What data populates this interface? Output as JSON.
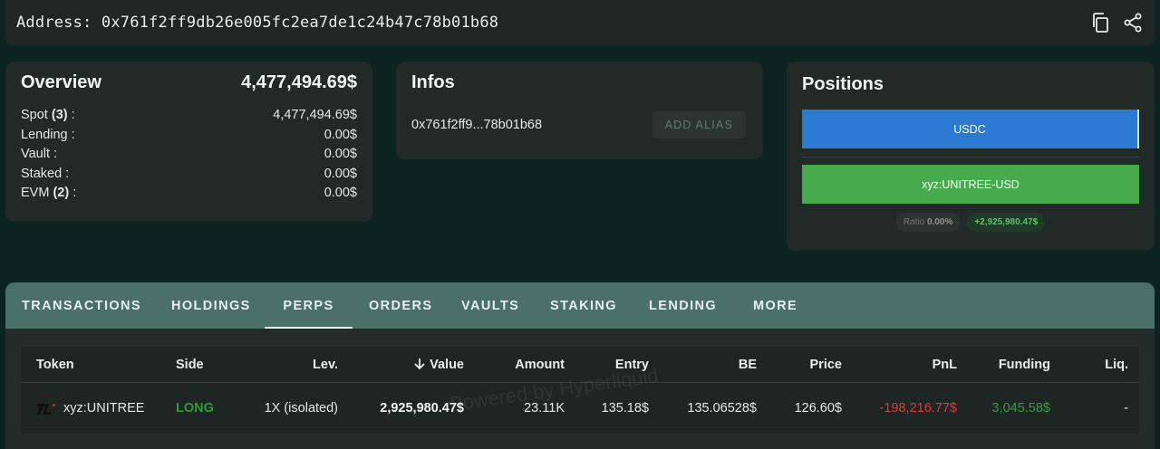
{
  "address_bar": {
    "label": "Address:",
    "address": "0x761f2ff9db26e005fc2ea7de1c24b47c78b01b68"
  },
  "overview": {
    "title": "Overview",
    "total": "4,477,494.69$",
    "rows": [
      {
        "label": "Spot",
        "count": "(3)",
        "suffix": " :",
        "value": "4,477,494.69$"
      },
      {
        "label": "Lending :",
        "count": "",
        "suffix": "",
        "value": "0.00$"
      },
      {
        "label": "Vault :",
        "count": "",
        "suffix": "",
        "value": "0.00$"
      },
      {
        "label": "Staked :",
        "count": "",
        "suffix": "",
        "value": "0.00$"
      },
      {
        "label": "EVM",
        "count": "(2)",
        "suffix": " :",
        "value": "0.00$"
      }
    ]
  },
  "infos": {
    "title": "Infos",
    "short_address": "0x761f2ff9...78b01b68",
    "alias_button": "ADD ALIAS"
  },
  "positions": {
    "title": "Positions",
    "bars": [
      "USDC",
      "xyz:UNITREE-USD"
    ],
    "ratio_label": "Ratio",
    "ratio_value": "0.00%",
    "pnl_badge": "+2,925,980.47$"
  },
  "tabs": [
    "TRANSACTIONS",
    "HOLDINGS",
    "PERPS",
    "ORDERS",
    "VAULTS",
    "STAKING",
    "LENDING",
    "MORE"
  ],
  "active_tab": "PERPS",
  "table": {
    "headers": {
      "token": "Token",
      "side": "Side",
      "lev": "Lev.",
      "value": "Value",
      "amount": "Amount",
      "entry": "Entry",
      "be": "BE",
      "price": "Price",
      "pnl": "PnL",
      "funding": "Funding",
      "liq": "Liq."
    },
    "rows": [
      {
        "token": "xyz:UNITREE",
        "side": "LONG",
        "lev": "1X (isolated)",
        "value": "2,925,980.47$",
        "amount": "23.11K",
        "entry": "135.18$",
        "be": "135.06528$",
        "price": "126.60$",
        "pnl": "-198,216.77$",
        "funding": "3,045.58$",
        "liq": "-"
      }
    ]
  },
  "watermark": "Powered by Hyperliquid",
  "colors": {
    "background": "#0c2420",
    "card": "#222a28",
    "tab_bar": "#4a7068",
    "usdc_bar": "#2b79d0",
    "unitree_bar": "#45ab4c",
    "long": "#2f9b35",
    "negative": "#e43535",
    "positive": "#3c9940"
  }
}
